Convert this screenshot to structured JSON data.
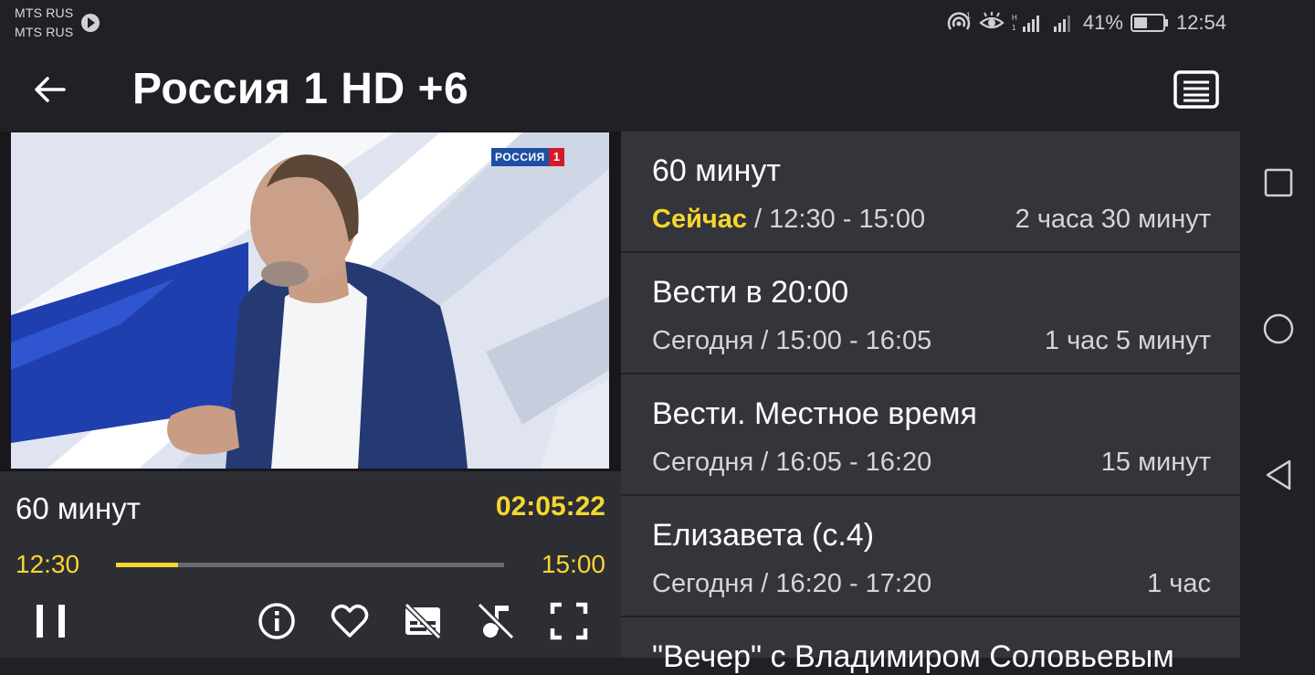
{
  "status_bar": {
    "carrier_1": "MTS RUS",
    "carrier_2": "MTS RUS",
    "battery_percent": "41%",
    "time": "12:54",
    "icons": [
      "hotspot-icon",
      "eye-icon",
      "signal-icon",
      "signal-icon",
      "battery-icon"
    ]
  },
  "app_bar": {
    "title": "Россия 1 HD +6",
    "back_icon": "arrow-back-icon",
    "epg_icon": "list-icon"
  },
  "video": {
    "channel_logo_word": "РОССИЯ",
    "channel_logo_number": "1"
  },
  "player": {
    "program_title": "60 минут",
    "remaining": "02:05:22",
    "start_time": "12:30",
    "end_time": "15:00",
    "progress_fraction": 0.16,
    "controls": [
      "pause-icon",
      "info-icon",
      "heart-icon",
      "subtitles-off-icon",
      "audio-track-off-icon",
      "fullscreen-icon"
    ]
  },
  "epg": {
    "items": [
      {
        "title": "60 минут",
        "day": "Сейчас",
        "time": " / 12:30  -  15:00",
        "duration": "2 часа 30 минут",
        "is_now": true
      },
      {
        "title": "Вести в 20:00",
        "day": "Сегодня",
        "time": " / 15:00  -  16:05",
        "duration": "1 час 5 минут"
      },
      {
        "title": "Вести. Местное время",
        "day": "Сегодня",
        "time": " / 16:05  -  16:20",
        "duration": "15 минут"
      },
      {
        "title": "Елизавета (с.4)",
        "day": "Сегодня",
        "time": " / 16:20  -  17:20",
        "duration": "1 час"
      },
      {
        "title": "\"Вечер\" с Владимиром Соловьевым"
      }
    ]
  },
  "colors": {
    "accent": "#f5d72e",
    "background": "#202027",
    "panel": "#2d2d34",
    "list_item": "#34343b"
  }
}
